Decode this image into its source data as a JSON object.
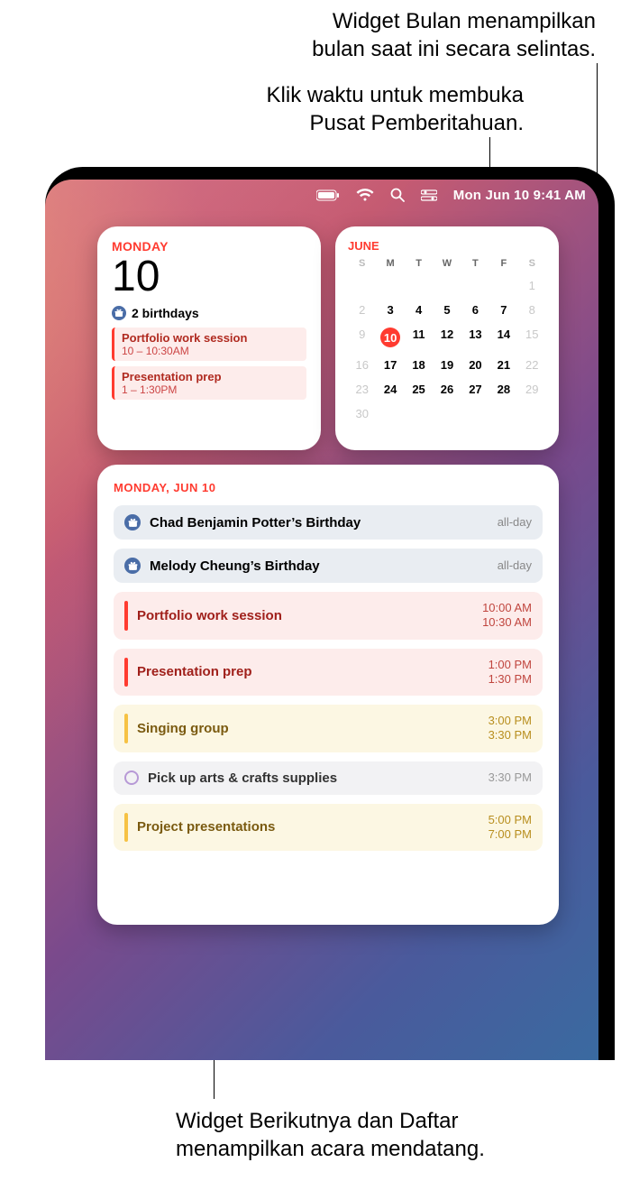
{
  "callouts": {
    "top1": "Widget Bulan menampilkan\nbulan saat ini secara selintas.",
    "top2": "Klik waktu untuk membuka\nPusat Pemberitahuan.",
    "bottom": "Widget Berikutnya dan Daftar\nmenampilkan acara mendatang."
  },
  "menubar": {
    "clock": "Mon Jun 10  9:41 AM"
  },
  "today_widget": {
    "dayname": "MONDAY",
    "daynum": "10",
    "birthdays_label": "2 birthdays",
    "events": [
      {
        "title": "Portfolio work session",
        "time": "10 – 10:30AM"
      },
      {
        "title": "Presentation prep",
        "time": "1 – 1:30PM"
      }
    ]
  },
  "month_widget": {
    "month": "JUNE",
    "dow": [
      "S",
      "M",
      "T",
      "W",
      "T",
      "F",
      "S"
    ],
    "weeks": [
      [
        "",
        "",
        "",
        "",
        "",
        "",
        "1"
      ],
      [
        "2",
        "3",
        "4",
        "5",
        "6",
        "7",
        "8"
      ],
      [
        "9",
        "10",
        "11",
        "12",
        "13",
        "14",
        "15"
      ],
      [
        "16",
        "17",
        "18",
        "19",
        "20",
        "21",
        "22"
      ],
      [
        "23",
        "24",
        "25",
        "26",
        "27",
        "28",
        "29"
      ],
      [
        "30",
        "",
        "",
        "",
        "",
        "",
        ""
      ]
    ],
    "today": "10",
    "weekend_cols": [
      0,
      6
    ]
  },
  "list_widget": {
    "date": "MONDAY, JUN 10",
    "events": [
      {
        "kind": "birthday",
        "title": "Chad Benjamin Potter’s Birthday",
        "time": "all-day"
      },
      {
        "kind": "birthday",
        "title": "Melody Cheung’s Birthday",
        "time": "all-day"
      },
      {
        "kind": "red",
        "title": "Portfolio work session",
        "start": "10:00 AM",
        "end": "10:30 AM"
      },
      {
        "kind": "red",
        "title": "Presentation prep",
        "start": "1:00 PM",
        "end": "1:30 PM"
      },
      {
        "kind": "yellow",
        "title": "Singing group",
        "start": "3:00 PM",
        "end": "3:30 PM"
      },
      {
        "kind": "task",
        "title": "Pick up arts & crafts supplies",
        "time": "3:30 PM"
      },
      {
        "kind": "yellow",
        "title": "Project presentations",
        "start": "5:00 PM",
        "end": "7:00 PM"
      }
    ]
  }
}
